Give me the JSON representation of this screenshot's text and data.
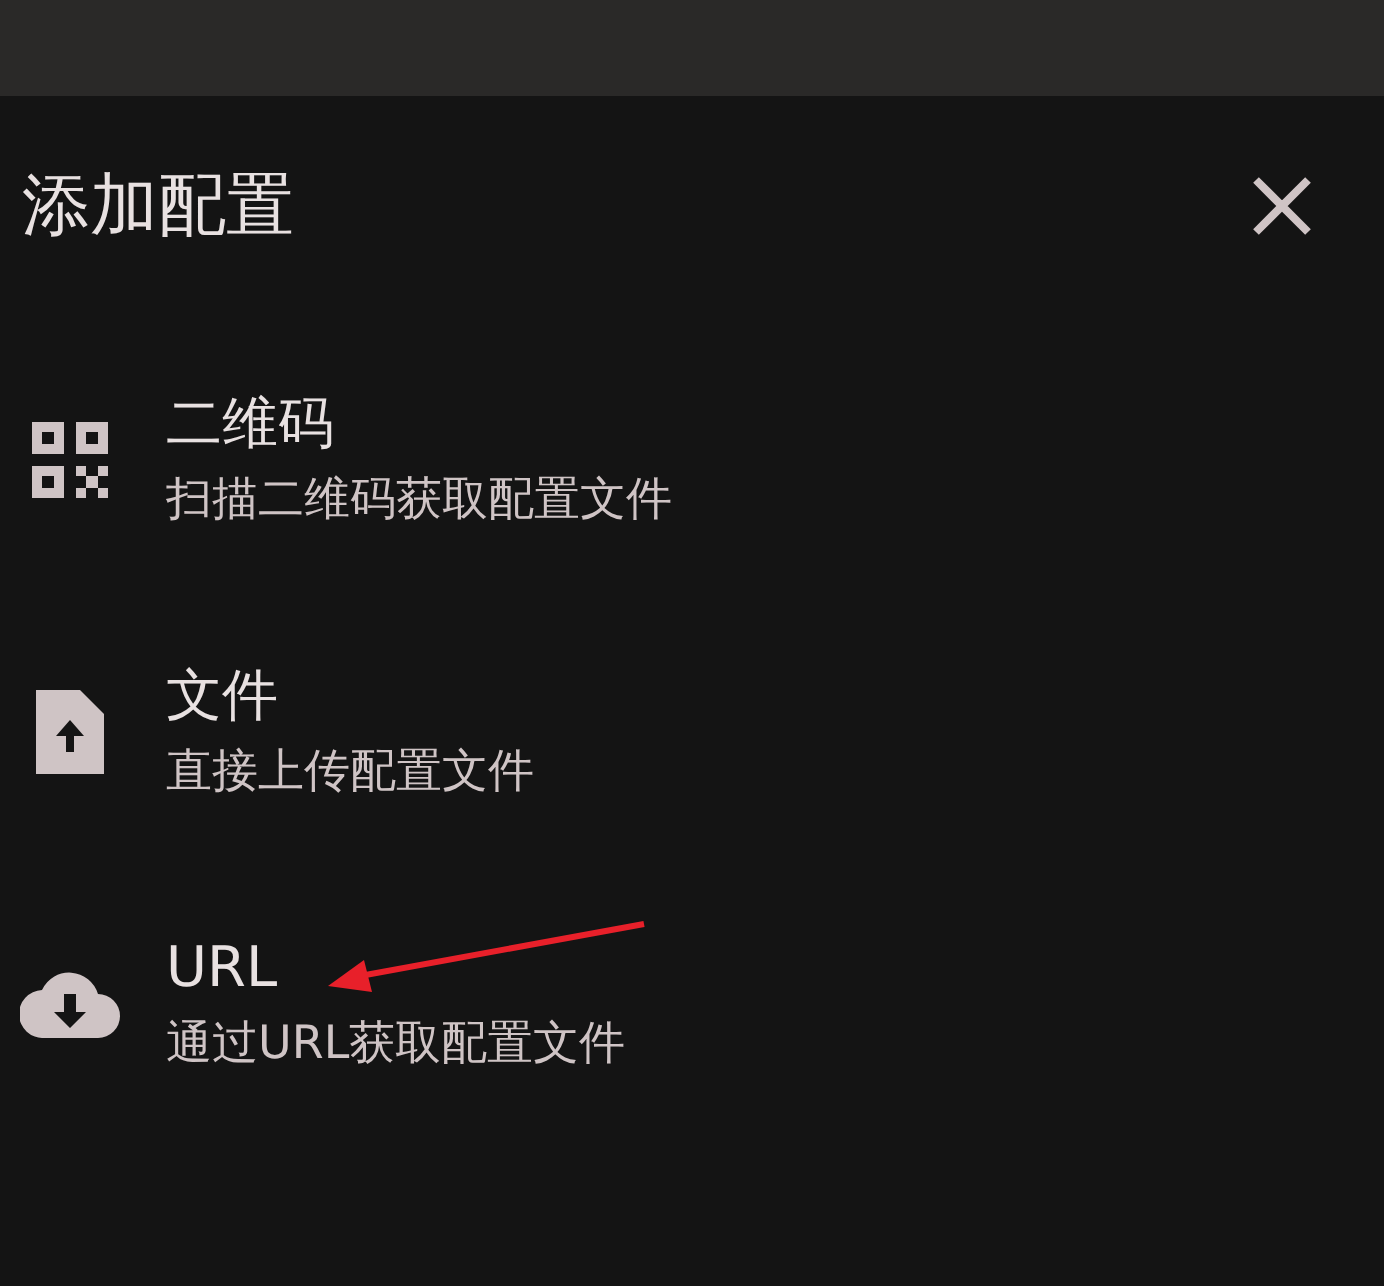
{
  "dialog": {
    "title": "添加配置"
  },
  "options": [
    {
      "kind": "qr",
      "title": "二维码",
      "subtitle": "扫描二维码获取配置文件"
    },
    {
      "kind": "file",
      "title": "文件",
      "subtitle": "直接上传配置文件"
    },
    {
      "kind": "url",
      "title": "URL",
      "subtitle": "通过URL获取配置文件"
    }
  ]
}
